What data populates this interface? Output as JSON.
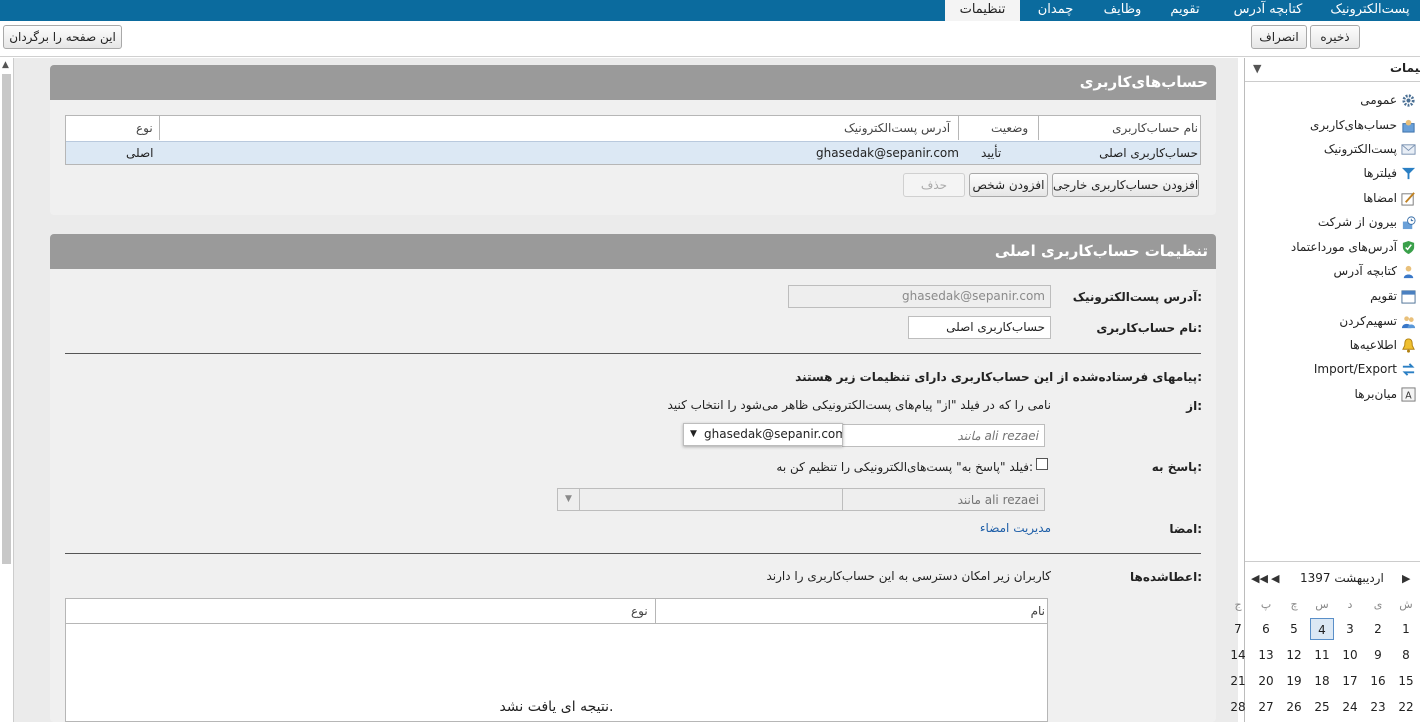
{
  "top_tabs": [
    {
      "label": "پست‌الکترونیک"
    },
    {
      "label": "کتابچه آدرس"
    },
    {
      "label": "تقویم"
    },
    {
      "label": "وظایف"
    },
    {
      "label": "چمدان"
    },
    {
      "label": "تنظیمات"
    }
  ],
  "toolbar": {
    "save_label": "ذخیره",
    "cancel_label": "انصراف",
    "revert_label": "این صفحه را برگردان"
  },
  "accounts_panel": {
    "title": "حساب‌های‌کاربری",
    "columns": [
      "نام حساب‌کاربری",
      "وضعیت",
      "آدرس پست‌الکترونیک",
      "نوع"
    ],
    "rows": [
      {
        "name": "حساب‌کاربری اصلی",
        "status": "تأیید",
        "email": "ghasedak@sepanir.com",
        "type": "اصلی"
      }
    ],
    "add_external_label": "افزودن حساب‌کاربری خارجی",
    "add_person_label": "افزودن شخص",
    "delete_label": "حذف"
  },
  "settings_panel": {
    "title": "تنظیمات حساب‌کاربری اصلی",
    "email_label": "آدرس پست‌الکترونیک:",
    "email_value": "ghasedak@sepanir.com",
    "account_name_label": "نام حساب‌کاربری:",
    "account_name_value": "حساب‌کاربری اصلی",
    "sent_heading": "پیامهای فرستاده‌شده از این حساب‌کاربری دارای تنظیمات زیر هستند:",
    "from_label": "از:",
    "from_desc": "نامی را که در فیلد \"از\" پیام‌های پست‌الکترونیکی ظاهر می‌شود را انتخاب کنید",
    "from_name_placeholder": "مانند ali rezaei",
    "from_email_selected": "ghasedak@sepanir.com",
    "reply_label": "پاسخ به:",
    "reply_checkbox_label": "فیلد \"پاسخ به\" پست‌های‌الکترونیکی را تنظیم کن به:",
    "reply_name_placeholder": "مانند ali rezaei",
    "signature_label": "امضا:",
    "signature_link": "مدیریت امضاء",
    "delegates_label": "اعطاشده‌ها:",
    "delegates_desc": "کاربران زیر امکان دسترسی به این حساب‌کاربری را دارند",
    "delegates_columns": [
      "نام",
      "نوع"
    ],
    "no_results": "نتیجه ای یافت نشد."
  },
  "sidebar": {
    "header": "تنظیمات",
    "items": [
      {
        "label": "عمومی",
        "icon": "gear-icon"
      },
      {
        "label": "حساب‌های‌کاربری",
        "icon": "accounts-icon"
      },
      {
        "label": "پست‌الکترونیک",
        "icon": "mail-icon"
      },
      {
        "label": "فیلترها",
        "icon": "filter-icon"
      },
      {
        "label": "امضاها",
        "icon": "signature-icon"
      },
      {
        "label": "بیرون از شرکت",
        "icon": "out-of-office-icon"
      },
      {
        "label": "آدرس‌های مورداعتماد",
        "icon": "shield-icon"
      },
      {
        "label": "کتابچه آدرس",
        "icon": "contact-icon"
      },
      {
        "label": "تقویم",
        "icon": "calendar-icon"
      },
      {
        "label": "تسهیم‌کردن",
        "icon": "share-icon"
      },
      {
        "label": "اطلاعیه‌ها",
        "icon": "bell-icon"
      },
      {
        "label": "Import/Export",
        "icon": "import-export-icon"
      },
      {
        "label": "میان‌برها",
        "icon": "shortcut-icon"
      }
    ]
  },
  "calendar": {
    "month_label": "اردیبهشت 1397",
    "day_headers": [
      "ش",
      "ی",
      "د",
      "س",
      "چ",
      "پ",
      "ج"
    ],
    "weeks": [
      [
        "1",
        "2",
        "3",
        "4",
        "5",
        "6",
        "7"
      ],
      [
        "8",
        "9",
        "10",
        "11",
        "12",
        "13",
        "14"
      ],
      [
        "15",
        "16",
        "17",
        "18",
        "19",
        "20",
        "21"
      ],
      [
        "22",
        "23",
        "24",
        "25",
        "26",
        "27",
        "28"
      ]
    ],
    "selected_day": "4"
  },
  "colors": {
    "topbar": "#0b6b9e",
    "panel_header": "#9a9a9a",
    "link": "#1f5fa8",
    "selected_row": "#dce8f4"
  }
}
